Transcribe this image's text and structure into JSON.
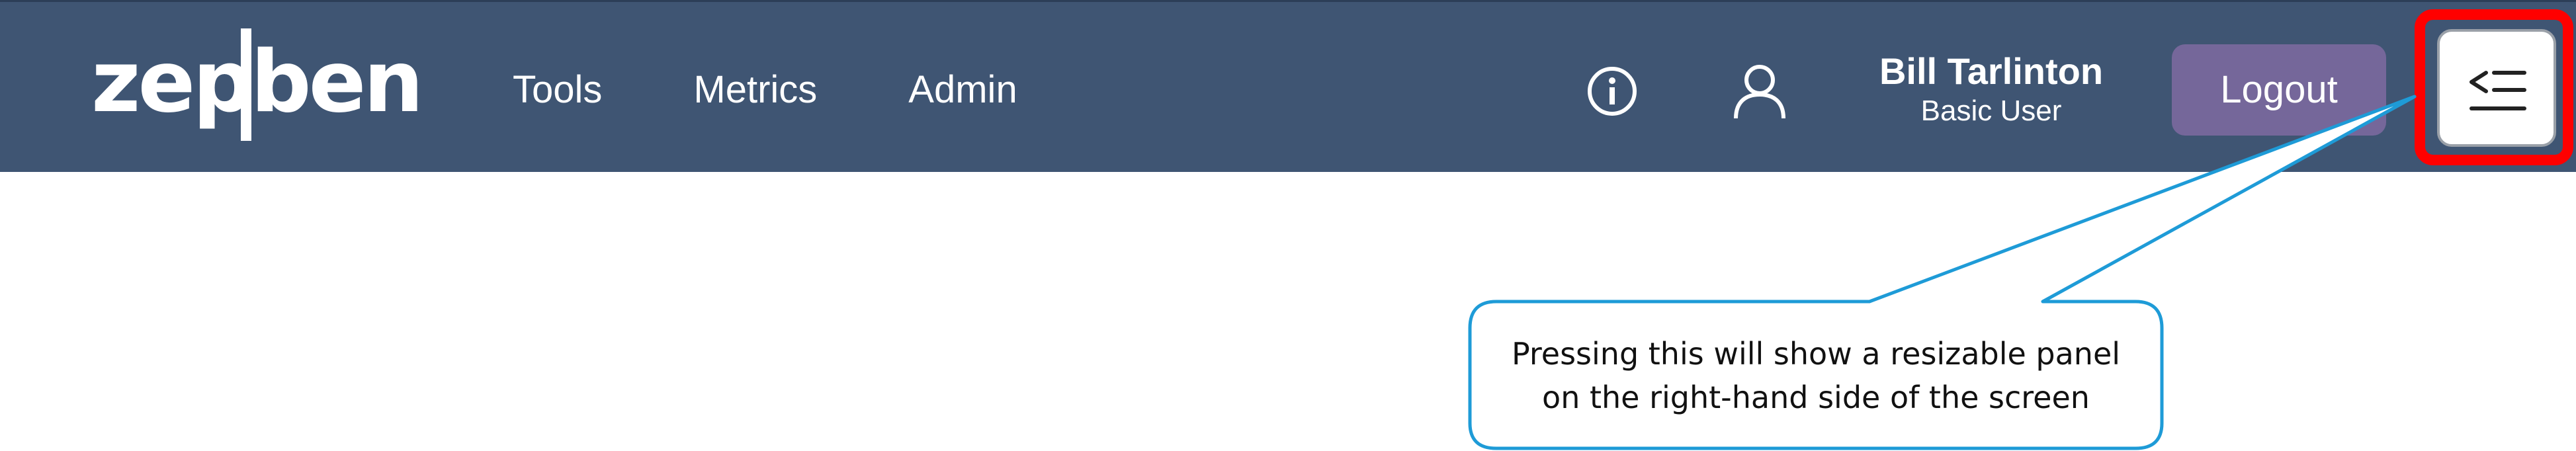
{
  "brand": {
    "logo_text": "zepben"
  },
  "nav": {
    "items": [
      {
        "label": "Tools"
      },
      {
        "label": "Metrics"
      },
      {
        "label": "Admin"
      }
    ]
  },
  "header_actions": {
    "info_icon": "info-circle-icon",
    "user_icon": "user-outline-icon"
  },
  "user": {
    "name": "Bill Tarlinton",
    "role": "Basic User"
  },
  "logout": {
    "label": "Logout"
  },
  "panel_toggle": {
    "icon": "panel-expand-icon",
    "highlight_color": "#ff0000"
  },
  "callout": {
    "line1": "Pressing this will show a resizable panel",
    "line2": "on the right-hand side of the screen",
    "border_color": "#1e9bd7"
  },
  "colors": {
    "navbar": "#3f5573",
    "logout_button": "#75679a"
  }
}
